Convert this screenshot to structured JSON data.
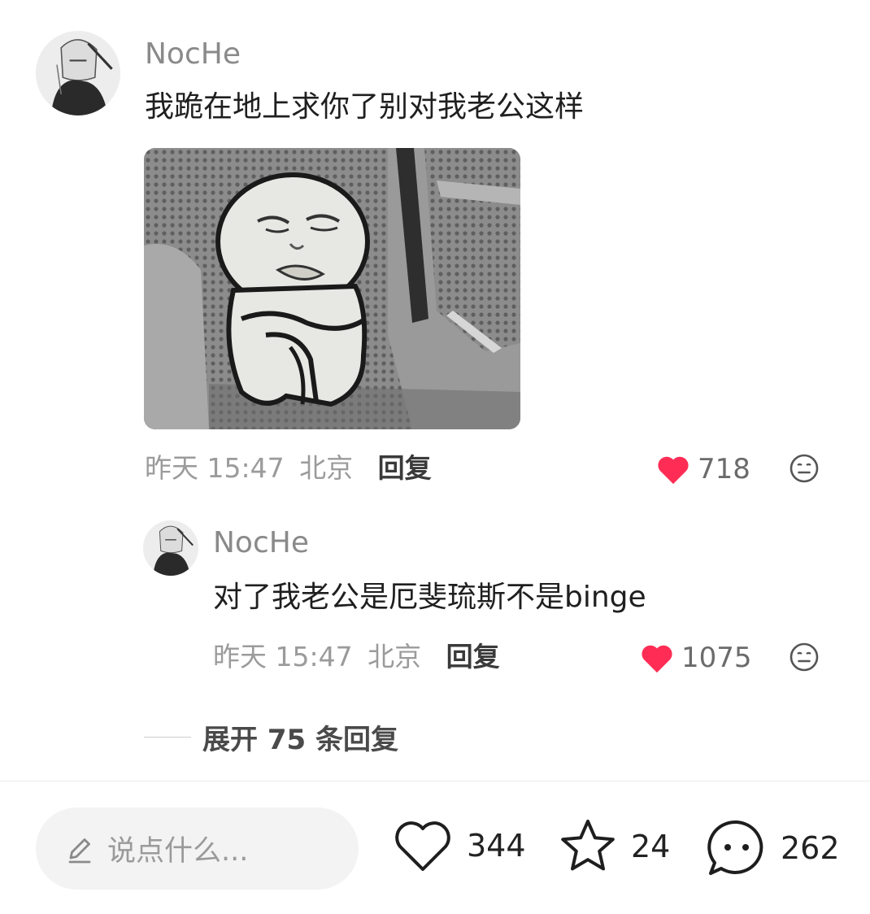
{
  "comment": {
    "username": "NocHe",
    "text": "我跪在地上求你了别对我老公这样",
    "time": "昨天 15:47",
    "location": "北京",
    "reply_label": "回复",
    "likes": "718"
  },
  "reply": {
    "username": "NocHe",
    "text": "对了我老公是厄斐琉斯不是binge",
    "time": "昨天 15:47",
    "location": "北京",
    "reply_label": "回复",
    "likes": "1075"
  },
  "expand_replies": "展开 75 条回复",
  "bottom_bar": {
    "input_placeholder": "说点什么...",
    "like_count": "344",
    "star_count": "24",
    "comment_count": "262"
  },
  "colors": {
    "like_red": "#ff2d55",
    "text_dark": "#1f1f1f",
    "text_muted": "#9b9b9b"
  },
  "icons": [
    "avatar",
    "sticker-image",
    "heart-filled-icon",
    "neutral-face-icon",
    "pencil-icon",
    "heart-outline-icon",
    "star-outline-icon",
    "chat-bubble-icon"
  ]
}
